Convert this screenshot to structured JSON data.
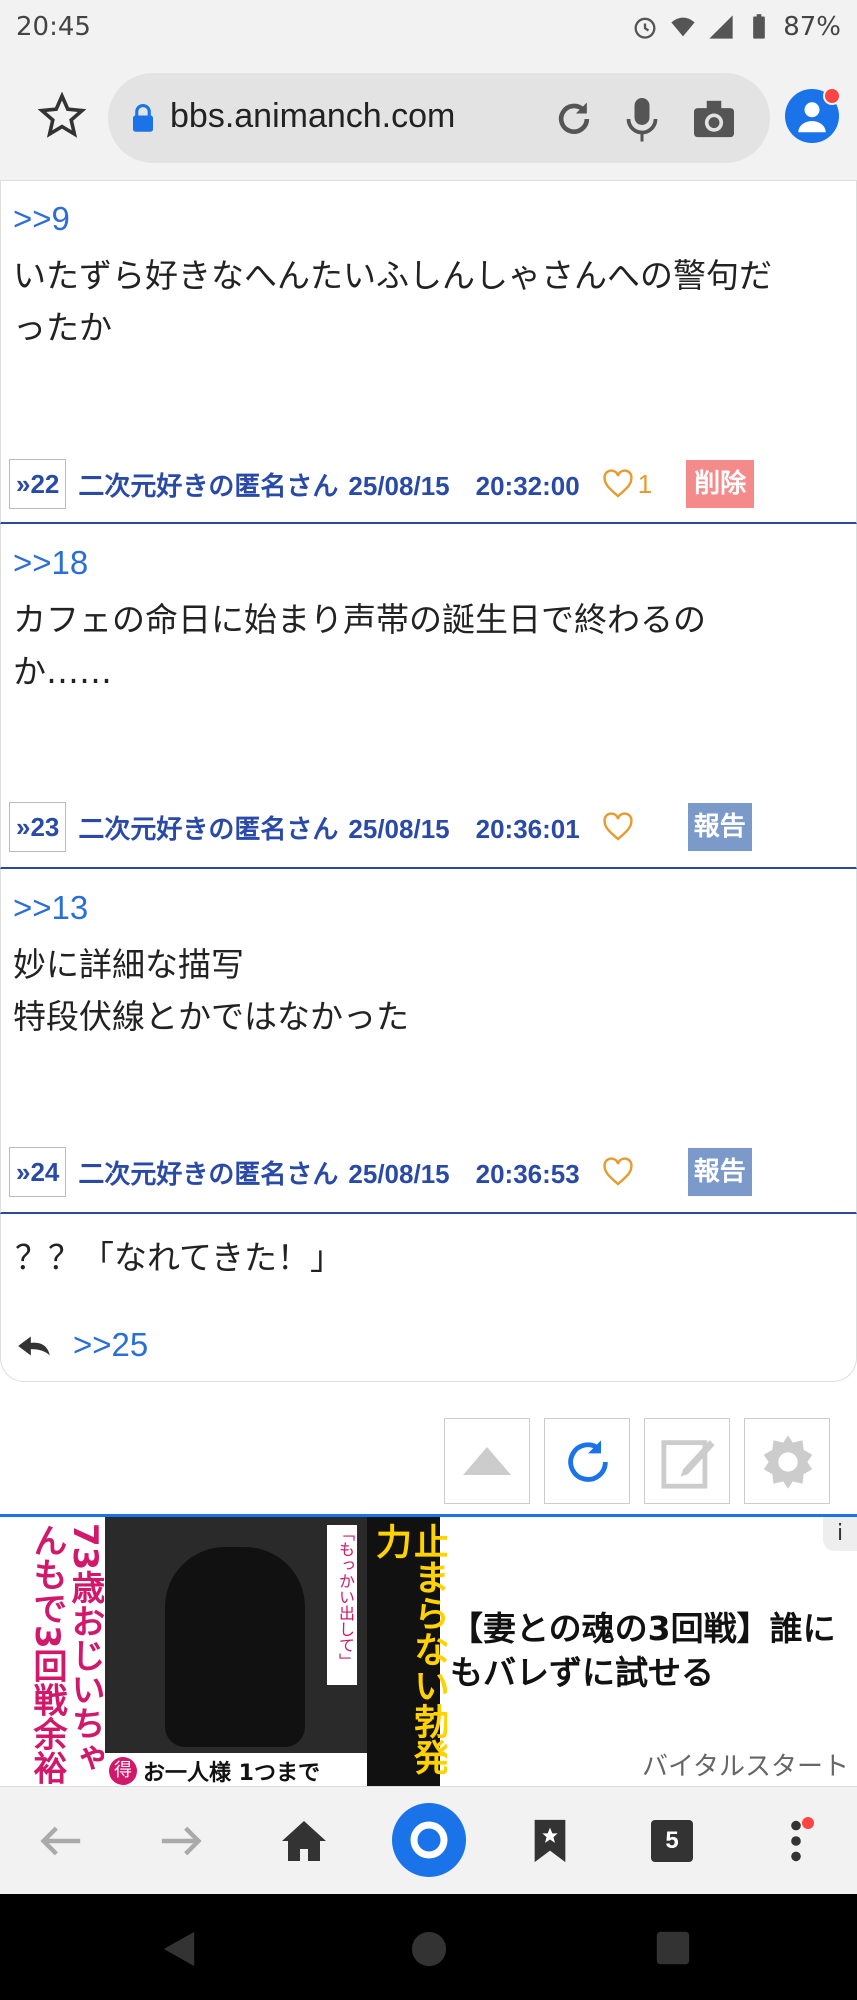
{
  "status_bar": {
    "time": "20:45",
    "battery": "87%"
  },
  "browser": {
    "url": "bbs.animanch.com",
    "tab_count": "5"
  },
  "posts": [
    {
      "anchor": ">>9",
      "lines": [
        "いたずら好きなへんたいふしんしゃさんへの警句だ",
        "ったか"
      ],
      "num": "»22",
      "author": "二次元好きの匿名さん",
      "date": "25/08/15　20:32:00",
      "likes": "1",
      "action": "削除"
    },
    {
      "anchor": ">>18",
      "lines": [
        "カフェの命日に始まり声帯の誕生日で終わるの",
        "か……"
      ],
      "num": "»23",
      "author": "二次元好きの匿名さん",
      "date": "25/08/15　20:36:01",
      "likes": "",
      "action": "報告"
    },
    {
      "anchor": ">>13",
      "lines": [
        "妙に詳細な描写",
        "特段伏線とかではなかった"
      ],
      "num": "»24",
      "author": "二次元好きの匿名さん",
      "date": "25/08/15　20:36:53",
      "likes": "",
      "action": "報告"
    }
  ],
  "draft": {
    "text": "？？「なれてきた！」",
    "reply_anchor": ">>25"
  },
  "ad": {
    "headline": "【妻との魂の3回戦】誰にもバレずに試せる",
    "source": "バイタルスタート",
    "info": "i",
    "image_text": {
      "left": "73歳おじいちゃんもで3回戦余裕",
      "center": "「もっかい出して」",
      "right": "止まらない勃発力",
      "bottom": "お一人様 1つまで",
      "badge": "得"
    }
  },
  "colors": {
    "accent": "#1a73e8",
    "link": "#2a6fd6",
    "meta": "#2a4aa8",
    "delete": "#f58a8a",
    "report": "#7b99c9",
    "heart": "#e89a2e"
  }
}
